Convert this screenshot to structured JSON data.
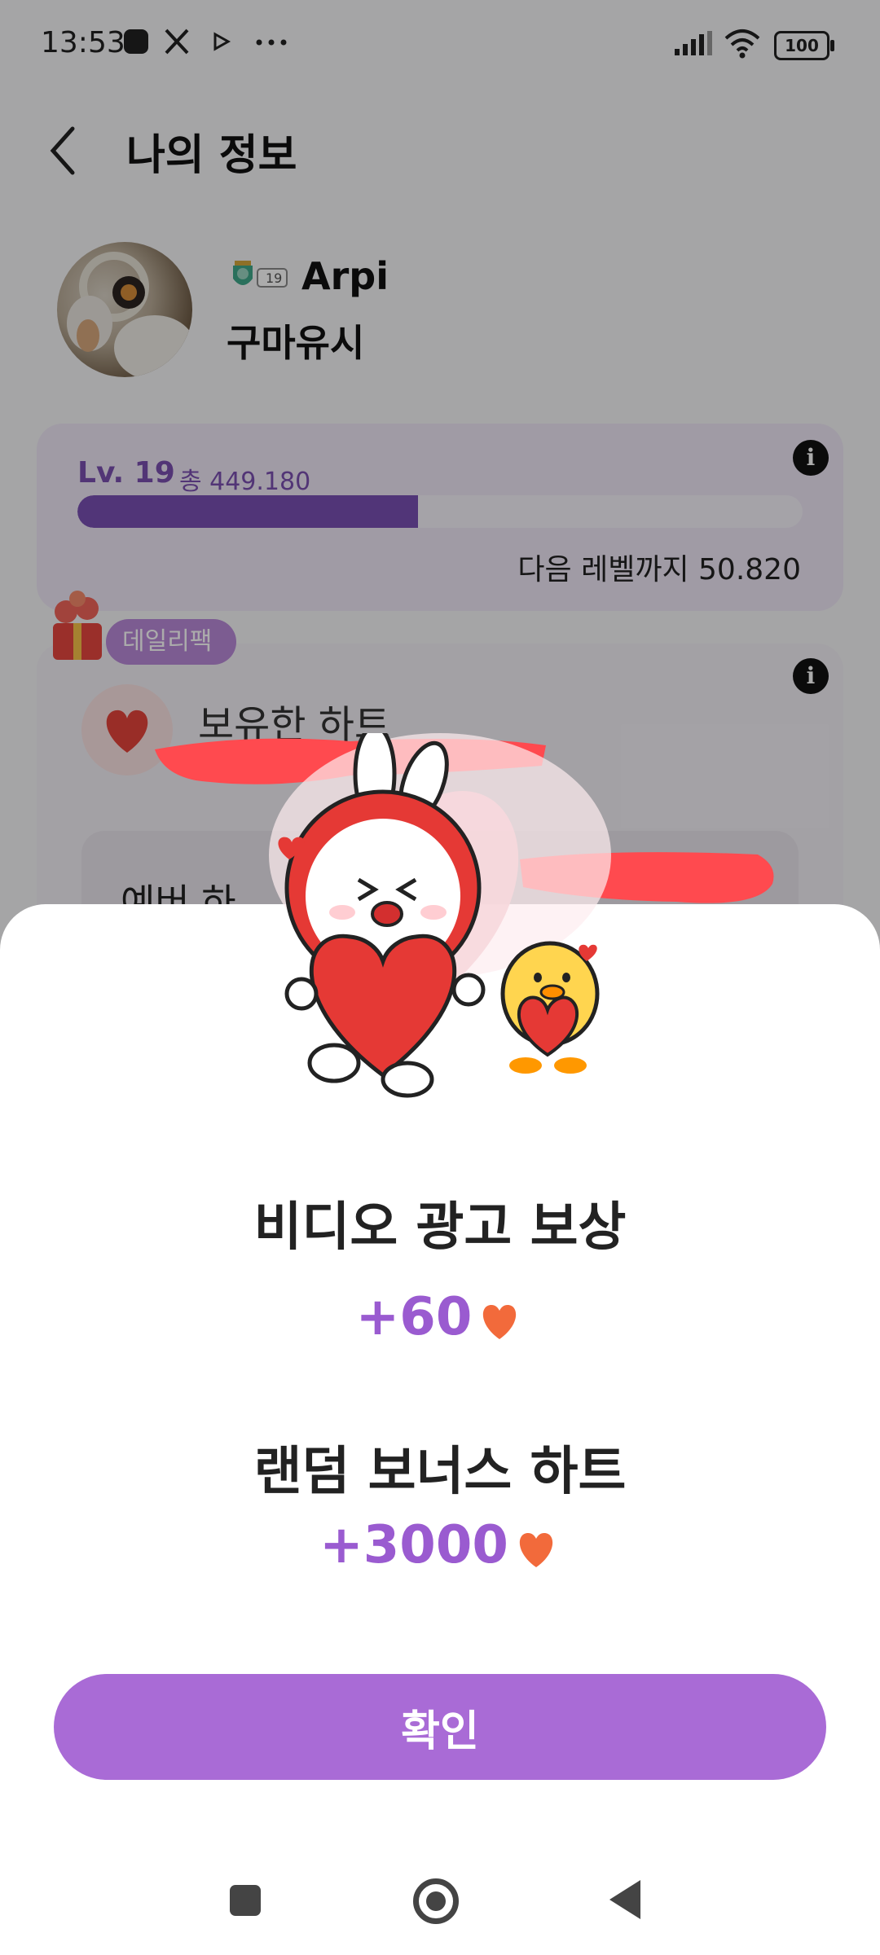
{
  "status_bar": {
    "time": "13:53",
    "battery": "100"
  },
  "header": {
    "title": "나의 정보"
  },
  "profile": {
    "name": "Arpi",
    "region": "구마유시",
    "badge_level": "19"
  },
  "level": {
    "label": "Lv. 19",
    "total": "총 449.180",
    "progress_fraction": 0.47,
    "next_level": "다음 레벨까지 50.820"
  },
  "hearts": {
    "daily_pack": "데일리팩",
    "owned_label": "보유한 하트",
    "event_label": "예버 하"
  },
  "dialog": {
    "title_1": "비디오 광고 보상",
    "amount_1": "+60",
    "title_2": "랜덤 보너스 하트",
    "amount_2": "+3000",
    "confirm": "확인"
  },
  "colors": {
    "accent": "#a96bd6",
    "level_bar": "#7a4fb3",
    "heart": "#e83a35",
    "redaction": "#ff4a4f"
  },
  "icons": [
    "back-icon",
    "signal-icon",
    "wifi-icon",
    "info-icon",
    "heart-icon",
    "gift-icon"
  ]
}
